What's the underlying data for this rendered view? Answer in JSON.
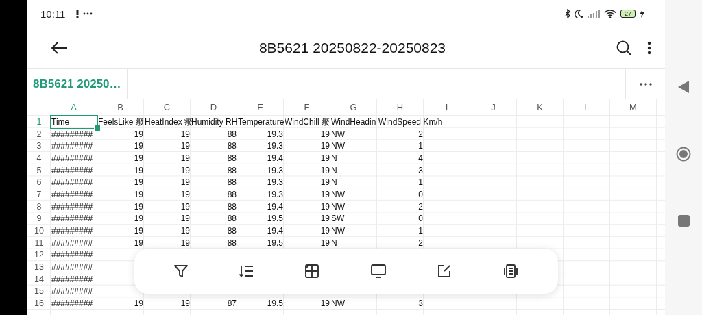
{
  "status_bar": {
    "time": "10:11",
    "battery": "27"
  },
  "app_bar": {
    "title": "8B5621 20250822-20250823"
  },
  "sheet_tabs": [
    {
      "label": "8B5621 20250…",
      "selected": true
    }
  ],
  "columns": [
    {
      "label": "A",
      "selected": true,
      "kind": "text"
    },
    {
      "label": "B",
      "selected": false,
      "kind": "number"
    },
    {
      "label": "C",
      "selected": false,
      "kind": "number"
    },
    {
      "label": "D",
      "selected": false,
      "kind": "number"
    },
    {
      "label": "E",
      "selected": false,
      "kind": "number"
    },
    {
      "label": "F",
      "selected": false,
      "kind": "number"
    },
    {
      "label": "G",
      "selected": false,
      "kind": "text"
    },
    {
      "label": "H",
      "selected": false,
      "kind": "number"
    },
    {
      "label": "I",
      "selected": false
    },
    {
      "label": "J",
      "selected": false
    },
    {
      "label": "K",
      "selected": false
    },
    {
      "label": "L",
      "selected": false
    },
    {
      "label": "M",
      "selected": false
    }
  ],
  "rows": [
    {
      "number": "1",
      "selected": true,
      "kind": "header",
      "cells": [
        "Time",
        "FeelsLike 癈",
        "HeatIndex 癈",
        "Humidity RH",
        "Temperature",
        "WindChill 癈",
        "WindHeadin",
        "WindSpeed Km/h"
      ]
    },
    {
      "number": "2",
      "selected": false,
      "kind": "data",
      "cells": [
        "#########",
        "19",
        "19",
        "88",
        "19.3",
        "19",
        "NW",
        "2"
      ]
    },
    {
      "number": "3",
      "selected": false,
      "kind": "data",
      "cells": [
        "#########",
        "19",
        "19",
        "88",
        "19.3",
        "19",
        "NW",
        "1"
      ]
    },
    {
      "number": "4",
      "selected": false,
      "kind": "data",
      "cells": [
        "#########",
        "19",
        "19",
        "88",
        "19.4",
        "19",
        "N",
        "4"
      ]
    },
    {
      "number": "5",
      "selected": false,
      "kind": "data",
      "cells": [
        "#########",
        "19",
        "19",
        "88",
        "19.3",
        "19",
        "N",
        "3"
      ]
    },
    {
      "number": "6",
      "selected": false,
      "kind": "data",
      "cells": [
        "#########",
        "19",
        "19",
        "88",
        "19.3",
        "19",
        "N",
        "1"
      ]
    },
    {
      "number": "7",
      "selected": false,
      "kind": "data",
      "cells": [
        "#########",
        "19",
        "19",
        "88",
        "19.3",
        "19",
        "NW",
        "0"
      ]
    },
    {
      "number": "8",
      "selected": false,
      "kind": "data",
      "cells": [
        "#########",
        "19",
        "19",
        "88",
        "19.4",
        "19",
        "NW",
        "2"
      ]
    },
    {
      "number": "9",
      "selected": false,
      "kind": "data",
      "cells": [
        "#########",
        "19",
        "19",
        "88",
        "19.5",
        "19",
        "SW",
        "0"
      ]
    },
    {
      "number": "10",
      "selected": false,
      "kind": "data",
      "cells": [
        "#########",
        "19",
        "19",
        "88",
        "19.4",
        "19",
        "NW",
        "1"
      ]
    },
    {
      "number": "11",
      "selected": false,
      "kind": "data",
      "cells": [
        "#########",
        "19",
        "19",
        "88",
        "19.5",
        "19",
        "N",
        "2"
      ]
    },
    {
      "number": "12",
      "selected": false,
      "kind": "data",
      "cells": [
        "#########"
      ]
    },
    {
      "number": "13",
      "selected": false,
      "kind": "data",
      "cells": [
        "#########"
      ]
    },
    {
      "number": "14",
      "selected": false,
      "kind": "data",
      "cells": [
        "#########"
      ]
    },
    {
      "number": "15",
      "selected": false,
      "kind": "data",
      "cells": [
        "#########"
      ]
    },
    {
      "number": "16",
      "selected": false,
      "kind": "data",
      "cells": [
        "#########",
        "19",
        "19",
        "87",
        "19.5",
        "19",
        "NW",
        "3"
      ]
    }
  ],
  "toolbar": [
    {
      "kind": "filter"
    },
    {
      "kind": "sort"
    },
    {
      "kind": "freeze"
    },
    {
      "kind": "display"
    },
    {
      "kind": "edit"
    },
    {
      "kind": "reader"
    }
  ]
}
